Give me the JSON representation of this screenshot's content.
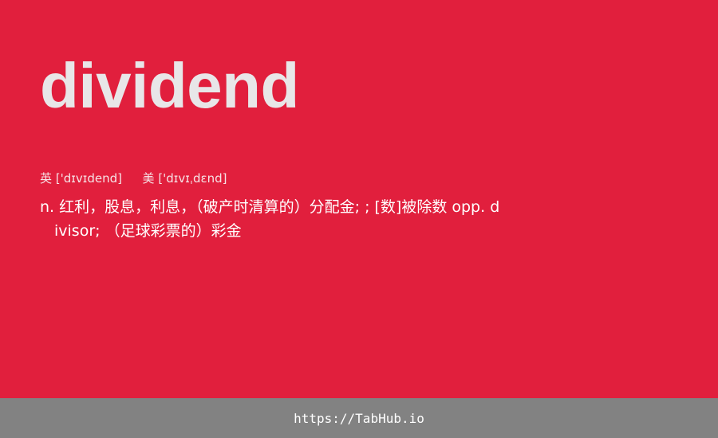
{
  "card": {
    "word": "dividend",
    "phonetics": {
      "uk_label": "英",
      "uk_ipa": "['dɪvɪdend]",
      "us_label": "美",
      "us_ipa": "['dɪvɪˌdɛnd]"
    },
    "definition": {
      "line1": "n. 红利，股息，利息，（破产时清算的）分配金; ; [数]被除数 opp. d",
      "line2": "ivisor; （足球彩票的）彩金"
    }
  },
  "footer": {
    "url": "https://TabHub.io"
  },
  "colors": {
    "card_background": "#e11f3d",
    "word_text": "#e8e6e8",
    "footer_background": "#828282"
  }
}
